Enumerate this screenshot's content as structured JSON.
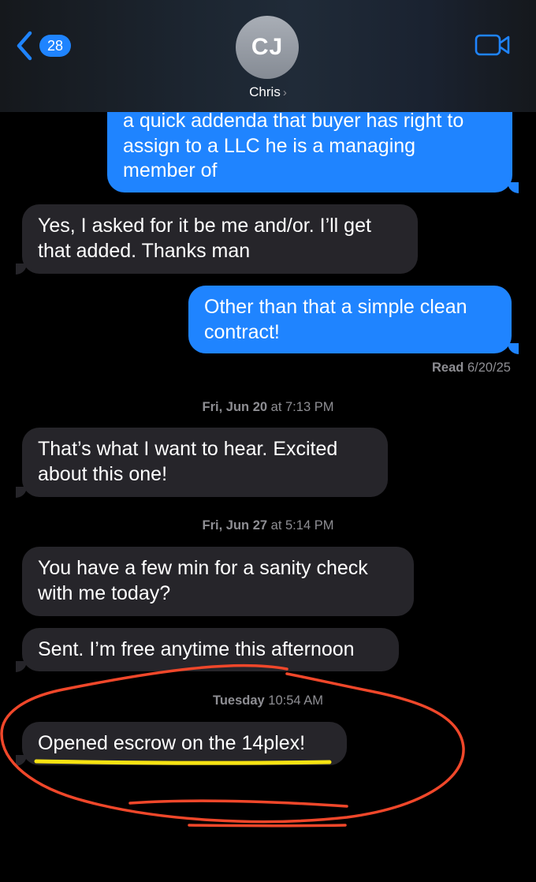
{
  "header": {
    "back_count": "28",
    "avatar_initials": "CJ",
    "contact_name": "Chris",
    "contact_chevron": "›",
    "accent_color": "#1f84ff"
  },
  "messages": [
    {
      "direction": "sent",
      "lines": [
        "a quick addenda that buyer has right to",
        "assign to a LLC he is a managing",
        "member of"
      ]
    },
    {
      "direction": "received",
      "lines": [
        "Yes, I asked for it be me and/or. I’ll get",
        "that added. Thanks man"
      ]
    },
    {
      "direction": "sent",
      "lines": [
        "Other than that a simple clean",
        "contract!"
      ]
    },
    {
      "direction": "received",
      "lines": [
        "That’s what I want to hear.  Excited",
        "about this one!"
      ]
    },
    {
      "direction": "received",
      "lines": [
        "You have a few min for a sanity check",
        "with me today?"
      ]
    },
    {
      "direction": "received",
      "lines": [
        "Sent. I’m free anytime this afternoon"
      ]
    },
    {
      "direction": "received",
      "lines": [
        "Opened escrow on the 14plex!"
      ]
    }
  ],
  "read_receipt": {
    "label": "Read",
    "date": "6/20/25"
  },
  "timestamps": [
    {
      "day": "Fri, Jun 20",
      "time": "at 7:13 PM"
    },
    {
      "day": "Fri, Jun 27",
      "time": "at 5:14 PM"
    },
    {
      "day": "Tuesday",
      "time": "10:54 AM"
    }
  ],
  "colors": {
    "sent_bubble": "#1f84ff",
    "received_bubble": "#26252a",
    "annotation_circle": "#f0472a",
    "annotation_underline": "#f7e312"
  }
}
